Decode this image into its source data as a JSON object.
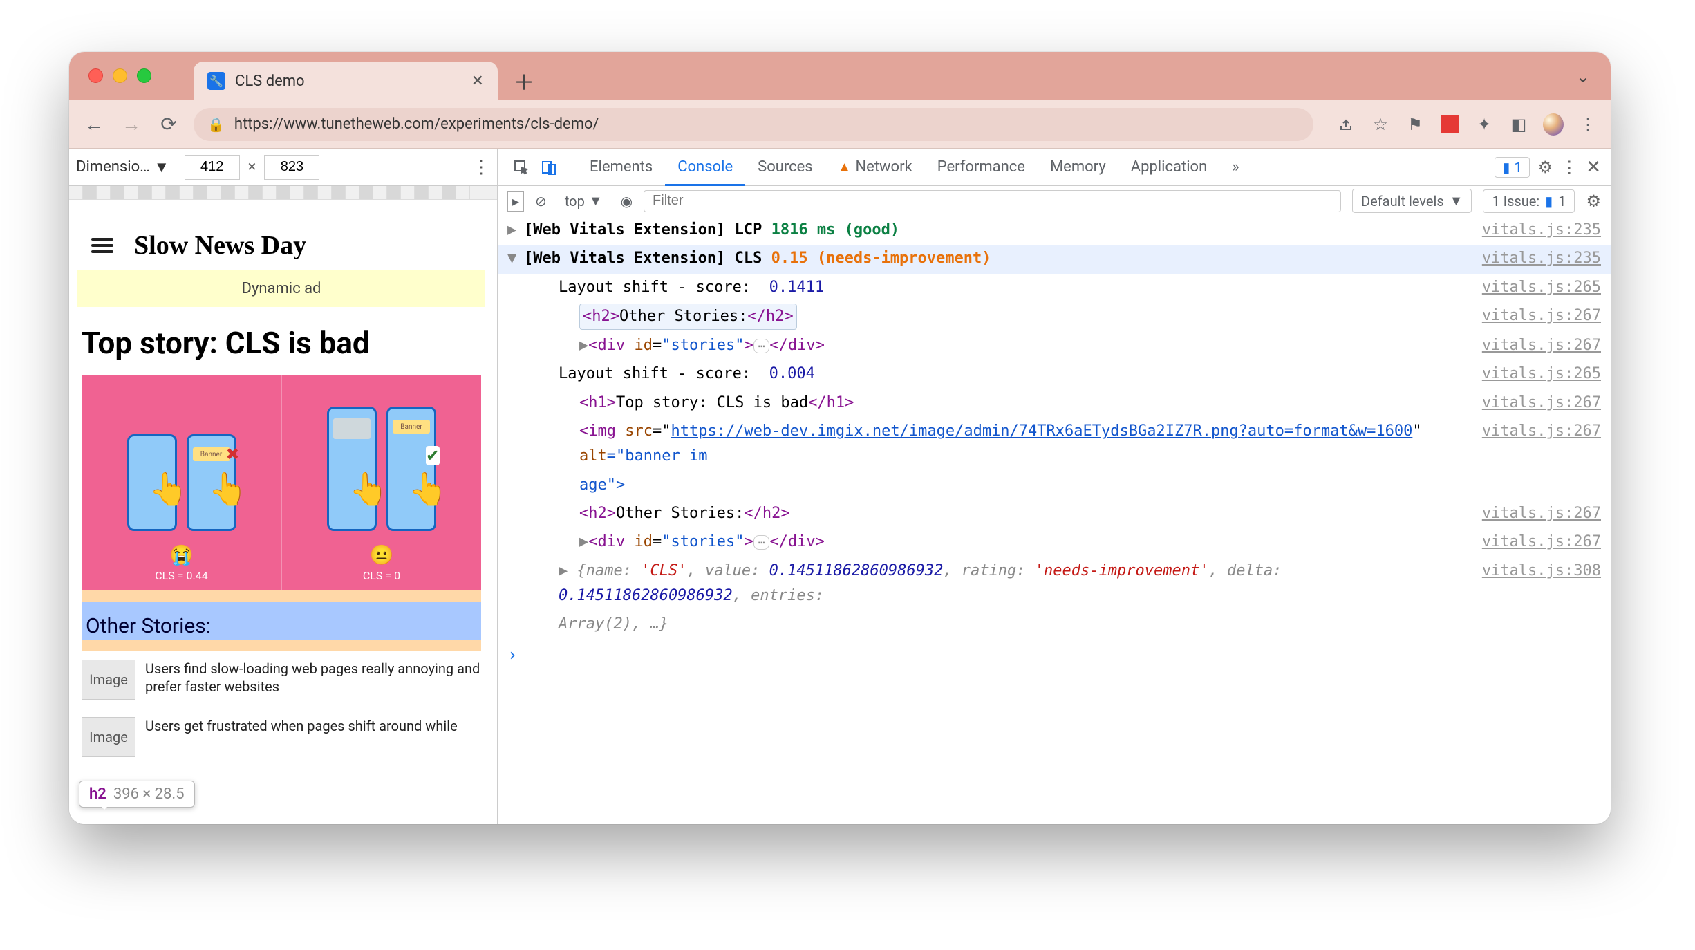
{
  "browser": {
    "tab_title": "CLS demo",
    "url_display": "https://www.tunetheweb.com/experiments/cls-demo/",
    "dim_label": "Dimensio…",
    "width": "412",
    "height": "823"
  },
  "page": {
    "site_title": "Slow News Day",
    "dynamic_ad": "Dynamic ad",
    "h1": "Top story: CLS is bad",
    "banner_left_caption": "CLS = 0.44",
    "banner_right_caption": "CLS = 0",
    "banner_strip": "Banner",
    "h2": "Other Stories:",
    "story1": "Users find slow-loading web pages really annoying and prefer faster websites",
    "story2": "Users get frustrated when pages shift around while",
    "image_placeholder": "Image",
    "tooltip_tag": "h2",
    "tooltip_dims": "396 × 28.5"
  },
  "devtools": {
    "tabs": {
      "elements": "Elements",
      "console": "Console",
      "sources": "Sources",
      "network": "Network",
      "performance": "Performance",
      "memory": "Memory",
      "application": "Application"
    },
    "badge_count": "1",
    "console_toolbar": {
      "context": "top",
      "filter_placeholder": "Filter",
      "levels": "Default levels",
      "issues_label": "1 Issue:",
      "issues_count": "1"
    },
    "messages": {
      "m0_prefix": "[Web Vitals Extension] LCP ",
      "m0_value": "1816 ms (good)",
      "m0_src": "vitals.js:235",
      "m1_prefix": "[Web Vitals Extension] CLS ",
      "m1_value": "0.15 (needs-improvement)",
      "m1_src": "vitals.js:235",
      "m2_label": "Layout shift - score:  ",
      "m2_value": "0.1411",
      "m2_src": "vitals.js:265",
      "m3_open": "<h2>",
      "m3_text": "Other Stories:",
      "m3_close": "</h2>",
      "m3_src": "vitals.js:267",
      "m4_open": "<div ",
      "m4_attr": "id",
      "m4_eq": "=",
      "m4_val": "\"stories\"",
      "m4_gt": ">",
      "m4_close": "</div>",
      "m4_src": "vitals.js:267",
      "m5_label": "Layout shift - score:  ",
      "m5_value": "0.004",
      "m5_src": "vitals.js:265",
      "m6_open": "<h1>",
      "m6_text": "Top story: CLS is bad",
      "m6_close": "</h1>",
      "m6_src": "vitals.js:267",
      "m7_src": "vitals.js:267",
      "m7_open": "<img ",
      "m7_attr1": "src",
      "m7_eq": "=\"",
      "m7_url": "https://web-dev.imgix.net/image/admin/74TRx6aETydsBGa2IZ7R.png?auto=format&w=1600",
      "m7_q": "\" ",
      "m7_attr2": "alt",
      "m7_val2": "=\"banner im",
      "m7_line2": "age\">",
      "m8_open": "<h2>",
      "m8_text": "Other Stories:",
      "m8_close": "</h2>",
      "m8_src": "vitals.js:267",
      "m9_open": "<div ",
      "m9_attr": "id",
      "m9_eq": "=",
      "m9_val": "\"stories\"",
      "m9_gt": ">",
      "m9_close": "</div>",
      "m9_src": "vitals.js:267",
      "m10_src": "vitals.js:308",
      "m10_text_a": "{name: ",
      "m10_cls": "'CLS'",
      "m10_text_b": ", value: ",
      "m10_val": "0.14511862860986932",
      "m10_text_c": ", rating: ",
      "m10_rating": "'needs-improvement'",
      "m10_text_d": ", delta: ",
      "m10_delta": "0.14511862860986932",
      "m10_text_e": ", entries: ",
      "m10_line2": "Array(2), …}"
    }
  }
}
